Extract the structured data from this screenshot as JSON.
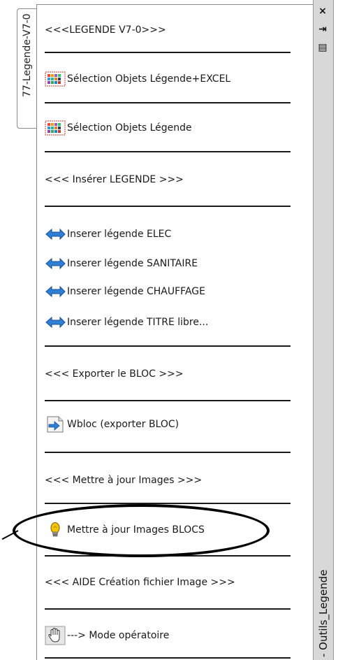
{
  "palette": {
    "tab_label": "77-Legende-V7-0",
    "title": "- Outils_Legende",
    "items": [
      {
        "label": "<<<LEGENDE V7-0>>>",
        "icon": "none"
      },
      {
        "label": "Sélection Objets Légende+EXCEL",
        "icon": "selection-grid-icon"
      },
      {
        "label": "Sélection Objets Légende",
        "icon": "selection-grid-icon"
      },
      {
        "label": "<<< Insérer LEGENDE >>>",
        "icon": "none"
      },
      {
        "label": "Inserer légende ELEC",
        "icon": "insert-arrow-icon"
      },
      {
        "label": "Inserer légende SANITAIRE",
        "icon": "insert-arrow-icon"
      },
      {
        "label": "Inserer légende CHAUFFAGE",
        "icon": "insert-arrow-icon"
      },
      {
        "label": "Inserer légende TITRE libre...",
        "icon": "insert-arrow-icon"
      },
      {
        "label": "<<< Exporter le BLOC >>>",
        "icon": "none"
      },
      {
        "label": "Wbloc (exporter BLOC)",
        "icon": "wblock-export-icon"
      },
      {
        "label": "<<< Mettre à jour Images >>>",
        "icon": "none"
      },
      {
        "label": "Mettre à jour Images BLOCS",
        "icon": "lightbulb-icon"
      },
      {
        "label": "<<< AIDE Création fichier Image >>>",
        "icon": "none"
      },
      {
        "label": "---> Mode opératoire",
        "icon": "hand-icon"
      }
    ]
  },
  "titlebar": {
    "close_glyph": "×",
    "autohide_glyph": "⇥",
    "properties_glyph": "▤"
  },
  "colors": {
    "text": "#1a1a1a",
    "titlebar_bg": "#d8d8d8",
    "arrow_blue": "#2f7fd6",
    "bulb_yellow": "#f2c400"
  }
}
